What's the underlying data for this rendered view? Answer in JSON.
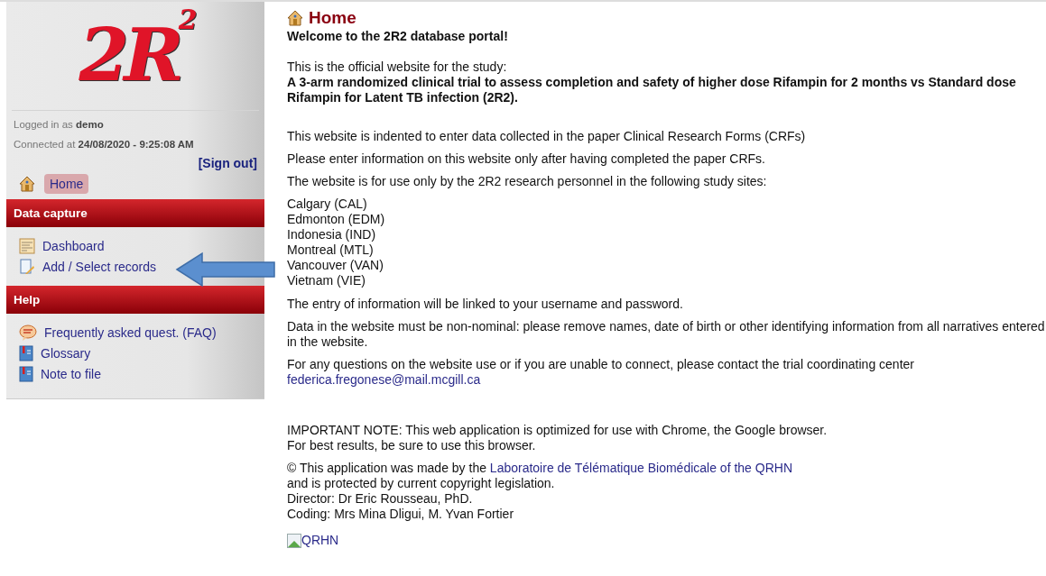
{
  "sidebar": {
    "logo": "2R$^{2}$",
    "session": {
      "logged_in_label": "Logged in as",
      "user": "demo",
      "connected_label": "Connected at",
      "connected_time": "24/08/2020 - 9:25:08 AM",
      "sign_out": "[Sign out]"
    },
    "home": {
      "label": "Home",
      "selected": true
    },
    "sections": [
      {
        "title": "Data capture",
        "items": [
          {
            "label": "Dashboard",
            "selected": false
          },
          {
            "label": "Add / Select records",
            "selected": false
          }
        ]
      },
      {
        "title": "Help",
        "items": [
          {
            "label": "Frequently asked quest. (FAQ)",
            "selected": false
          },
          {
            "label": "Glossary",
            "selected": false
          },
          {
            "label": "Note to file",
            "selected": false
          }
        ]
      }
    ]
  },
  "main": {
    "title": "Home",
    "welcome": "Welcome to the 2R2 database portal!",
    "study_intro": "This is the official website for the study:",
    "study_title": "A 3-arm randomized clinical trial to assess completion and safety of higher dose Rifampin for 2 months vs Standard dose Rifampin for Latent TB infection (2R2).",
    "paragraphs": [
      "This website is indented to enter data collected in the paper Clinical Research Forms (CRFs)",
      "Please enter information on this website only after having completed the paper CRFs.",
      "The website is for use only by the 2R2 research personnel in the following study sites:"
    ],
    "sites": [
      "Calgary (CAL)",
      "Edmonton (EDM)",
      "Indonesia (IND)",
      "Montreal (MTL)",
      "Vancouver (VAN)",
      "Vietnam (VIE)"
    ],
    "paragraphs_2": [
      "The entry of information will be linked to your username and password.",
      "Data in the website must be non-nominal: please remove names, date of birth or other identifying information from all narratives entered in the website."
    ],
    "contact_text": "For any questions on the website use or if you are unable to connect, please contact the trial coordinating center",
    "contact_email": "federica.fregonese@mail.mcgill.ca",
    "note_lines": [
      "IMPORTANT NOTE: This web application is optimized for use with Chrome, the Google browser.",
      "For best results, be sure to use this browser."
    ],
    "credit_prefix": "© This application was made by the",
    "credit_link": "Laboratoire de Télématique Biomédicale of the QRHN",
    "credit_lines": [
      "and is protected by current copyright legislation.",
      "Director: Dr Eric Rousseau, PhD.",
      "Coding: Mrs Mina Dligui, M. Yvan Fortier"
    ],
    "broken_image_alt": "QRHN"
  }
}
